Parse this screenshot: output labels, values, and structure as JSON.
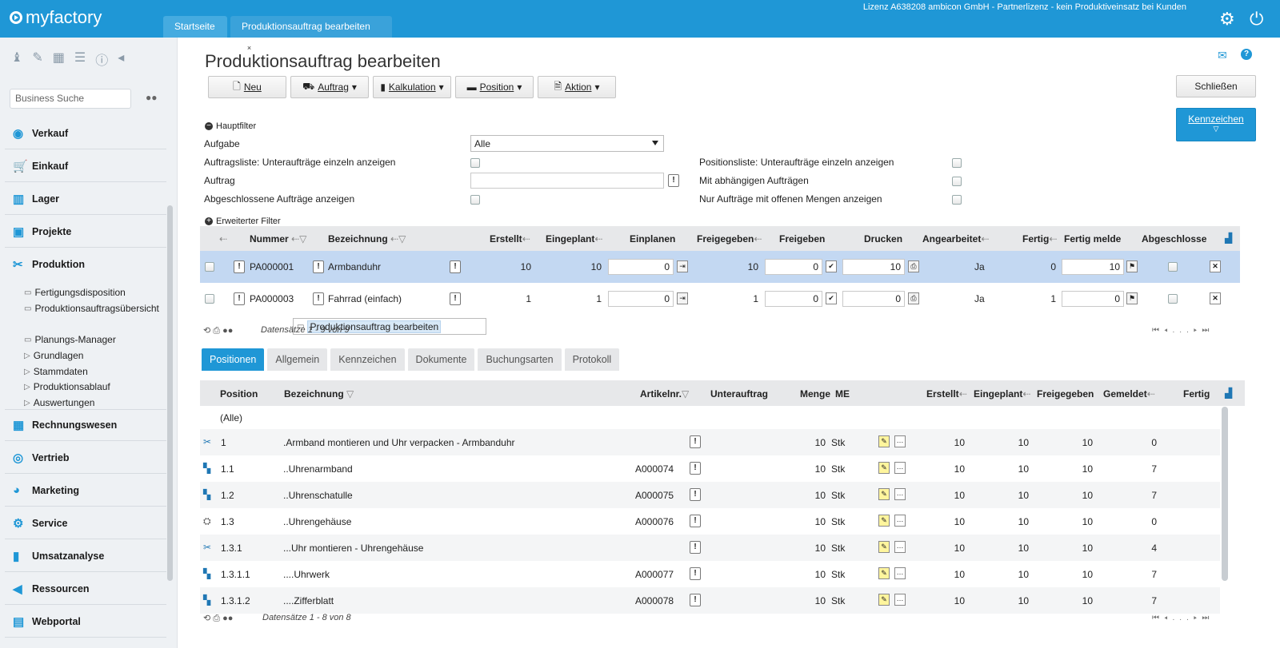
{
  "app": {
    "logo": "myfactory",
    "license": "Lizenz A638208 ambicon GmbH - Partnerlizenz - kein Produktiveinsatz bei Kunden",
    "tabs": [
      {
        "label": "Startseite"
      },
      {
        "label": "Produktionsauftrag bearbeiten",
        "close": "×"
      }
    ]
  },
  "sidebar": {
    "search_placeholder": "Business Suche",
    "main_items": [
      {
        "label": "Verkauf",
        "icon": "coins-icon"
      },
      {
        "label": "Einkauf",
        "icon": "cart-icon"
      },
      {
        "label": "Lager",
        "icon": "warehouse-icon"
      },
      {
        "label": "Projekte",
        "icon": "projects-icon"
      },
      {
        "label": "Produktion",
        "icon": "production-icon"
      },
      {
        "label": "Rechnungswesen",
        "icon": "accounting-icon"
      },
      {
        "label": "Vertrieb",
        "icon": "sales-icon"
      },
      {
        "label": "Marketing",
        "icon": "marketing-icon"
      },
      {
        "label": "Service",
        "icon": "service-icon"
      },
      {
        "label": "Umsatzanalyse",
        "icon": "chart-icon"
      },
      {
        "label": "Ressourcen",
        "icon": "resources-icon"
      },
      {
        "label": "Webportal",
        "icon": "webportal-icon"
      }
    ],
    "sub_items": [
      {
        "label": "Fertigungsdisposition",
        "type": "page"
      },
      {
        "label": "Produktionsauftragsübersicht",
        "type": "page"
      },
      {
        "label": "Produktionsauftrag bearbeiten",
        "type": "page",
        "selected": true
      },
      {
        "label": "Planungs-Manager",
        "type": "page"
      },
      {
        "label": "Grundlagen",
        "type": "folder"
      },
      {
        "label": "Stammdaten",
        "type": "folder"
      },
      {
        "label": "Produktionsablauf",
        "type": "folder"
      },
      {
        "label": "Auswertungen",
        "type": "folder"
      }
    ]
  },
  "page": {
    "title": "Produktionsauftrag bearbeiten",
    "toolbar": {
      "neu": "Neu",
      "auftrag": "Auftrag",
      "kalkulation": "Kalkulation",
      "position": "Position",
      "aktion": "Aktion",
      "schliessen": "Schließen",
      "kennzeichen": "Kennzeichen"
    },
    "filter": {
      "hauptfilter": "Hauptfilter",
      "erweiterter": "Erweiterter Filter",
      "aufgabe_label": "Aufgabe",
      "aufgabe_value": "Alle",
      "auftragsliste_label": "Auftragsliste: Unteraufträge einzeln anzeigen",
      "auftrag_label": "Auftrag",
      "abgeschlossene_label": "Abgeschlossene Aufträge anzeigen",
      "positionsliste_label": "Positionsliste: Unteraufträge einzeln anzeigen",
      "abhaengig_label": "Mit abhängigen Aufträgen",
      "offene_label": "Nur Aufträge mit offenen Mengen anzeigen"
    },
    "orders": {
      "headers": {
        "nummer": "Nummer",
        "bezeichnung": "Bezeichnung",
        "erstellt": "Erstellt",
        "eingeplant": "Eingeplant",
        "einplanen": "Einplanen",
        "freigegeben": "Freigegeben",
        "freigeben": "Freigeben",
        "drucken": "Drucken",
        "angearbeitet": "Angearbeitet",
        "fertig": "Fertig",
        "fertig_melden": "Fertig melden",
        "abgeschlossen": "Abgeschlossen"
      },
      "rows": [
        {
          "nummer": "PA000001",
          "bezeichnung": "Armbanduhr",
          "erstellt": "10",
          "eingeplant": "10",
          "einplanen": "0",
          "freigegeben": "10",
          "freigeben": "0",
          "drucken": "10",
          "angearbeitet": "Ja",
          "fertig": "0",
          "fertig_melden": "10"
        },
        {
          "nummer": "PA000003",
          "bezeichnung": "Fahrrad (einfach)",
          "erstellt": "1",
          "eingeplant": "1",
          "einplanen": "0",
          "freigegeben": "1",
          "freigeben": "0",
          "drucken": "0",
          "angearbeitet": "Ja",
          "fertig": "1",
          "fertig_melden": "0"
        }
      ],
      "footer": "Datensätze 1 - 9 von 9",
      "pager_dots": "..."
    },
    "detail_tabs": [
      "Positionen",
      "Allgemein",
      "Kennzeichen",
      "Dokumente",
      "Buchungsarten",
      "Protokoll"
    ],
    "positions": {
      "headers": {
        "position": "Position",
        "bezeichnung": "Bezeichnung",
        "artikelnr": "Artikelnr.",
        "unterauftrag": "Unterauftrag",
        "menge": "Menge",
        "me": "ME",
        "erstellt": "Erstellt",
        "eingeplant": "Eingeplant",
        "freigegeben": "Freigegeben",
        "gemeldet": "Gemeldet",
        "fertig": "Fertig"
      },
      "all_label": "(Alle)",
      "rows": [
        {
          "icon": "operation-icon",
          "pos": "1",
          "bez": ".Armband montieren und Uhr verpacken - Armbanduhr",
          "art": "",
          "menge": "10",
          "me": "Stk",
          "erstellt": "10",
          "eingeplant": "10",
          "freigegeben": "10",
          "gemeldet": "0"
        },
        {
          "icon": "material-icon",
          "pos": "1.1",
          "bez": "..Uhrenarmband",
          "art": "A000074",
          "menge": "10",
          "me": "Stk",
          "erstellt": "10",
          "eingeplant": "10",
          "freigegeben": "10",
          "gemeldet": "7"
        },
        {
          "icon": "material-icon",
          "pos": "1.2",
          "bez": "..Uhrenschatulle",
          "art": "A000075",
          "menge": "10",
          "me": "Stk",
          "erstellt": "10",
          "eingeplant": "10",
          "freigegeben": "10",
          "gemeldet": "7"
        },
        {
          "icon": "assembly-icon",
          "pos": "1.3",
          "bez": "..Uhrengehäuse",
          "art": "A000076",
          "menge": "10",
          "me": "Stk",
          "erstellt": "10",
          "eingeplant": "10",
          "freigegeben": "10",
          "gemeldet": "0"
        },
        {
          "icon": "operation-icon",
          "pos": "1.3.1",
          "bez": "...Uhr montieren - Uhrengehäuse",
          "art": "",
          "menge": "10",
          "me": "Stk",
          "erstellt": "10",
          "eingeplant": "10",
          "freigegeben": "10",
          "gemeldet": "4"
        },
        {
          "icon": "material-icon",
          "pos": "1.3.1.1",
          "bez": "....Uhrwerk",
          "art": "A000077",
          "menge": "10",
          "me": "Stk",
          "erstellt": "10",
          "eingeplant": "10",
          "freigegeben": "10",
          "gemeldet": "7"
        },
        {
          "icon": "material-icon",
          "pos": "1.3.1.2",
          "bez": "....Zifferblatt",
          "art": "A000078",
          "menge": "10",
          "me": "Stk",
          "erstellt": "10",
          "eingeplant": "10",
          "freigegeben": "10",
          "gemeldet": "7"
        }
      ],
      "footer": "Datensätze 1 - 8 von 8"
    }
  },
  "colors": {
    "accent": "#1f97d6",
    "highlight_row": "#c3d8f2"
  }
}
